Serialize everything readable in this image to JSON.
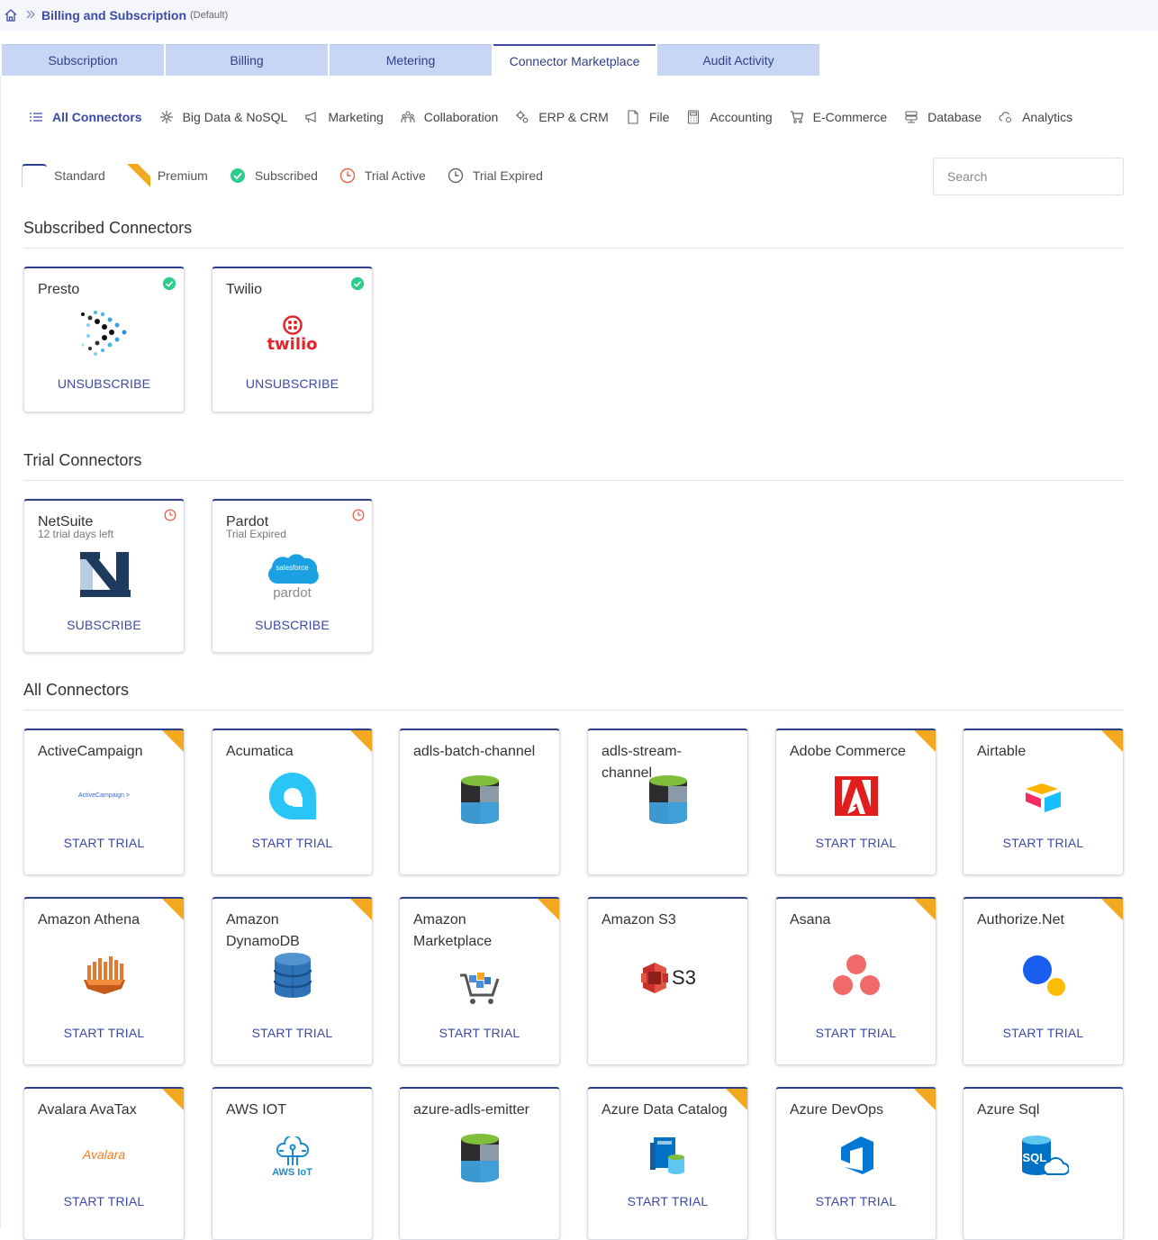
{
  "breadcrumb": {
    "title": "Billing and Subscription",
    "subtitle": "(Default)"
  },
  "tabs": [
    "Subscription",
    "Billing",
    "Metering",
    "Connector Marketplace",
    "Audit Activity"
  ],
  "categories": [
    "All Connectors",
    "Big Data & NoSQL",
    "Marketing",
    "Collaboration",
    "ERP & CRM",
    "File",
    "Accounting",
    "E-Commerce",
    "Database",
    "Analytics"
  ],
  "legend": [
    "Standard",
    "Premium",
    "Subscribed",
    "Trial Active",
    "Trial Expired"
  ],
  "search": {
    "placeholder": "Search"
  },
  "sections": {
    "subscribed": "Subscribed Connectors",
    "trial": "Trial Connectors",
    "all": "All Connectors"
  },
  "subscribed": [
    {
      "name": "Presto",
      "action": "UNSUBSCRIBE"
    },
    {
      "name": "Twilio",
      "action": "UNSUBSCRIBE",
      "logo_text": "twilio"
    }
  ],
  "trial": [
    {
      "name": "NetSuite",
      "sub": "12 trial days left",
      "action": "SUBSCRIBE"
    },
    {
      "name": "Pardot",
      "sub": "Trial Expired",
      "action": "SUBSCRIBE",
      "logo_text": "salesforce",
      "logo_text2": "pardot"
    }
  ],
  "all_connectors": [
    {
      "name": "ActiveCampaign",
      "action": "START TRIAL",
      "logo_text": "ActiveCampaign >"
    },
    {
      "name": "Acumatica",
      "action": "START TRIAL"
    },
    {
      "name": "adls-batch-channel",
      "action": ""
    },
    {
      "name": "adls-stream-channel",
      "action": ""
    },
    {
      "name": "Adobe Commerce",
      "action": "START TRIAL"
    },
    {
      "name": "Airtable",
      "action": "START TRIAL"
    },
    {
      "name": "Amazon Athena",
      "action": "START TRIAL"
    },
    {
      "name": "Amazon DynamoDB",
      "action": "START TRIAL"
    },
    {
      "name": "Amazon Marketplace",
      "action": "START TRIAL"
    },
    {
      "name": "Amazon S3",
      "action": "",
      "logo_text": "S3"
    },
    {
      "name": "Asana",
      "action": "START TRIAL"
    },
    {
      "name": "Authorize.Net",
      "action": "START TRIAL"
    },
    {
      "name": "Avalara AvaTax",
      "action": "START TRIAL",
      "logo_text": "Avalara"
    },
    {
      "name": "AWS IOT",
      "action": "",
      "logo_text": "AWS IoT"
    },
    {
      "name": "azure-adls-emitter",
      "action": ""
    },
    {
      "name": "Azure Data Catalog",
      "action": "START TRIAL"
    },
    {
      "name": "Azure DevOps",
      "action": "START TRIAL"
    },
    {
      "name": "Azure Sql",
      "action": "",
      "logo_text": "SQL"
    }
  ],
  "colors": {
    "accent": "#3b4aa8",
    "premium": "#f2a91f",
    "subscribed": "#2ecc8a",
    "trial": "#e8604c"
  }
}
